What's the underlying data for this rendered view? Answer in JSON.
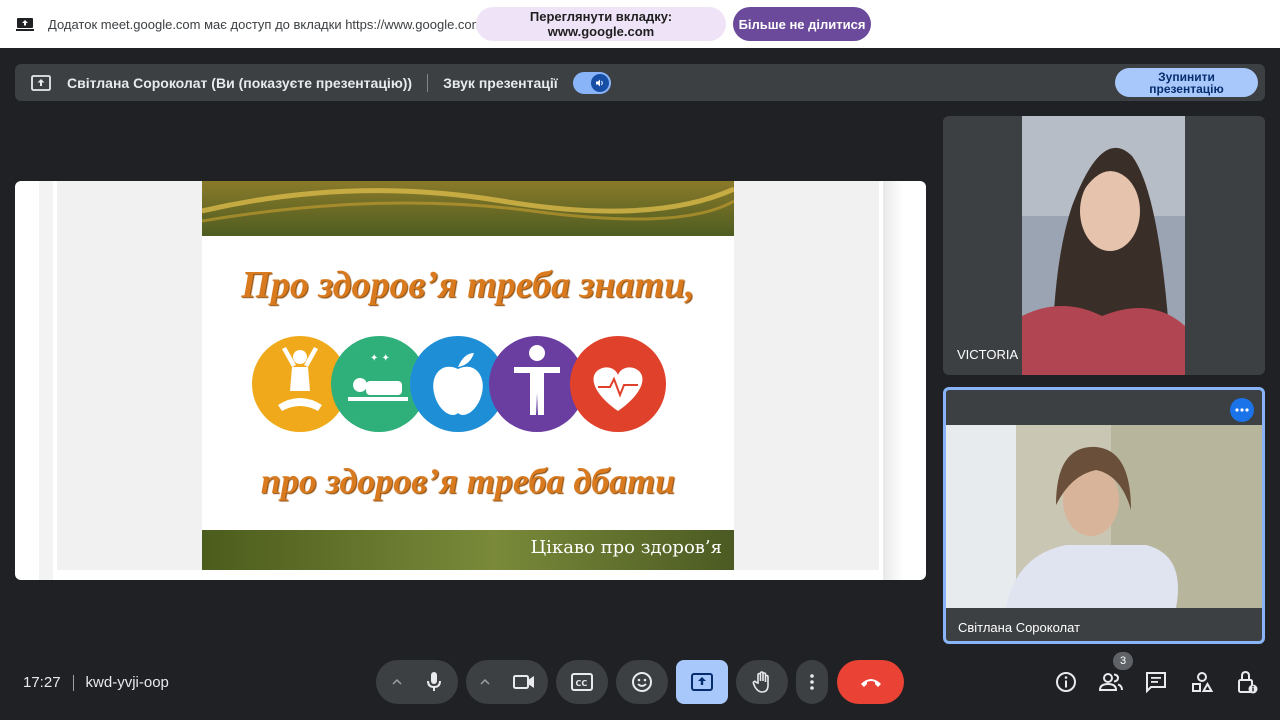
{
  "share_bar": {
    "message": "Додаток meet.google.com має доступ до вкладки https://www.google.com",
    "view_tab_label": "Переглянути вкладку: www.google.com",
    "stop_sharing_label": "Більше не ділитися",
    "icon": "screen-share-icon"
  },
  "presenting_bar": {
    "presenter_text": "Світлана Сороколат (Ви (показуєте презентацію))",
    "sound_label": "Звук презентації",
    "sound_enabled": true,
    "stop_presenting_label": "Зупинити презентацію",
    "icon": "present-icon"
  },
  "slide": {
    "line1": "Про здоров’я треба знати,",
    "line2": "про здоров’я треба дбати",
    "caption": "Цікаво про здоров’я",
    "circle_icons": [
      "yoga-icon",
      "sleep-icon",
      "apple-icon",
      "person-icon",
      "heart-icon"
    ],
    "circle_colors": [
      "#f0a91b",
      "#2fb07a",
      "#1e8fd6",
      "#6a3ea1",
      "#e0412a"
    ]
  },
  "participants": [
    {
      "name": "VICTORIA"
    },
    {
      "name": "Світлана Сороколат"
    }
  ],
  "meeting": {
    "time": "17:27",
    "code": "kwd-yvji-oop",
    "participants_count": "3"
  },
  "colors": {
    "background": "#202124",
    "end_call": "#ea4335",
    "active_present": "#a8c7fa",
    "accent": "#8ab4f8"
  }
}
